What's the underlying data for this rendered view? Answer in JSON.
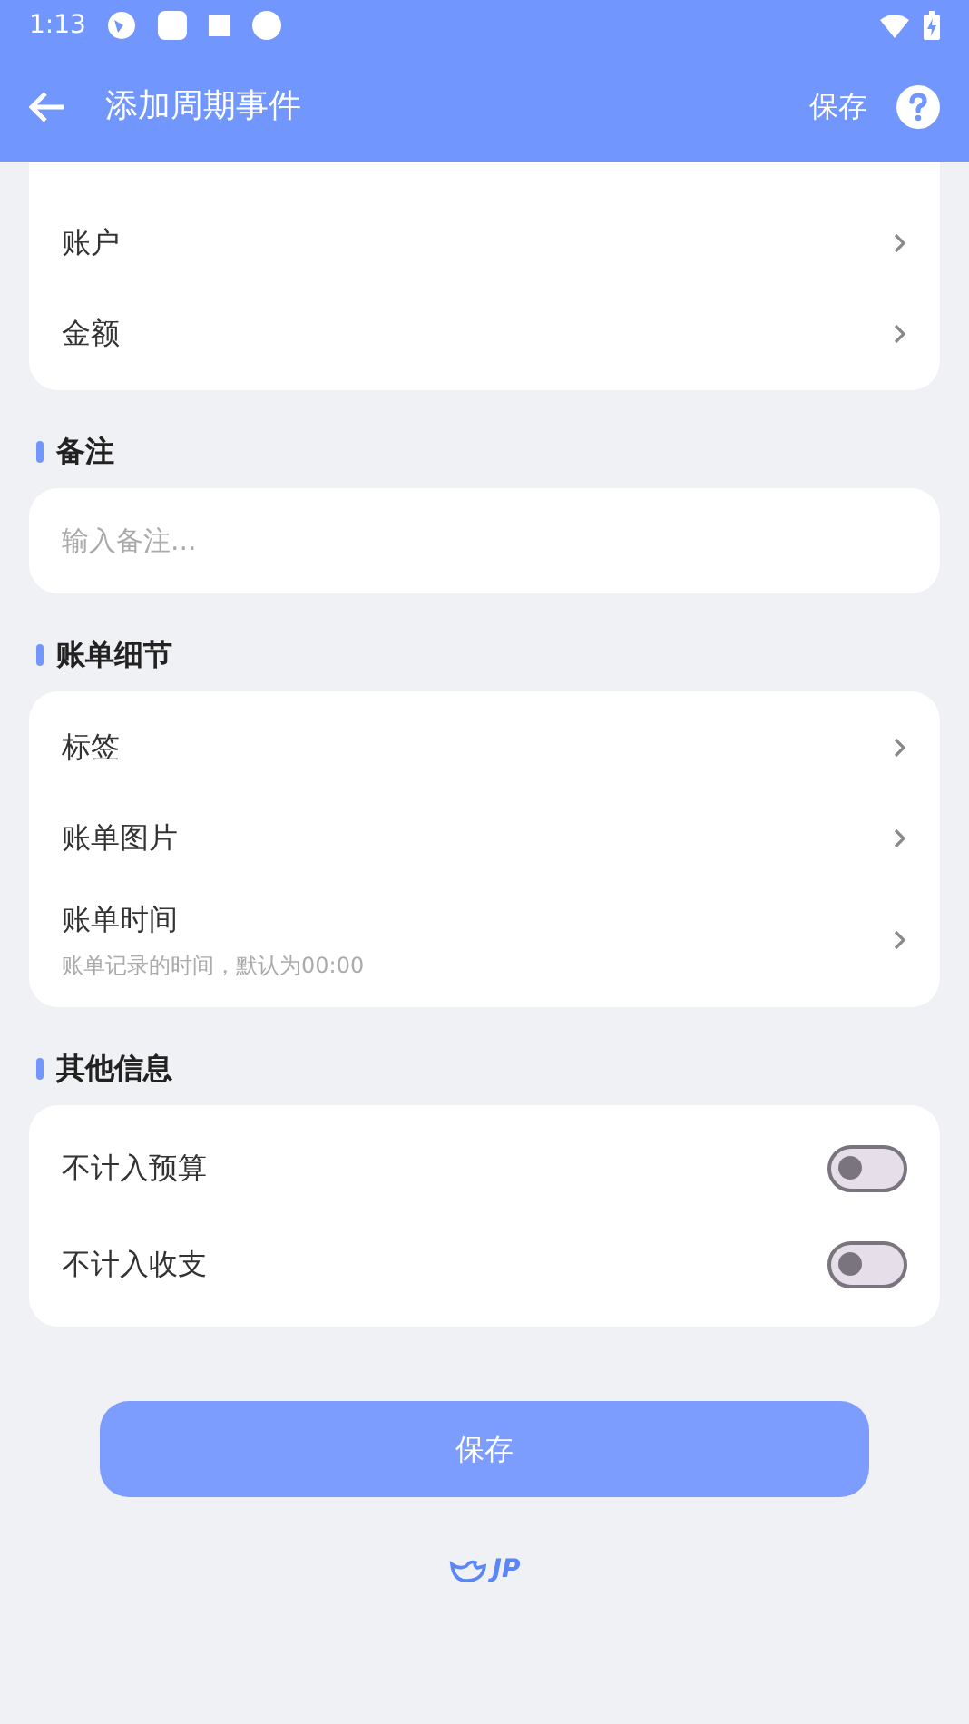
{
  "status_bar": {
    "time": "1:13"
  },
  "app_bar": {
    "title": "添加周期事件",
    "action": "保存"
  },
  "top_card": {
    "rows": [
      {
        "label": "账户"
      },
      {
        "label": "金额"
      }
    ]
  },
  "note_section": {
    "title": "备注",
    "placeholder": "输入备注..."
  },
  "detail_section": {
    "title": "账单细节",
    "rows": [
      {
        "label": "标签"
      },
      {
        "label": "账单图片"
      },
      {
        "label": "账单时间",
        "hint": "账单记录的时间，默认为00:00"
      }
    ]
  },
  "other_section": {
    "title": "其他信息",
    "toggles": [
      {
        "label": "不计入预算",
        "on": false
      },
      {
        "label": "不计入收支",
        "on": false
      }
    ]
  },
  "save_button": "保存",
  "logo": "JP"
}
